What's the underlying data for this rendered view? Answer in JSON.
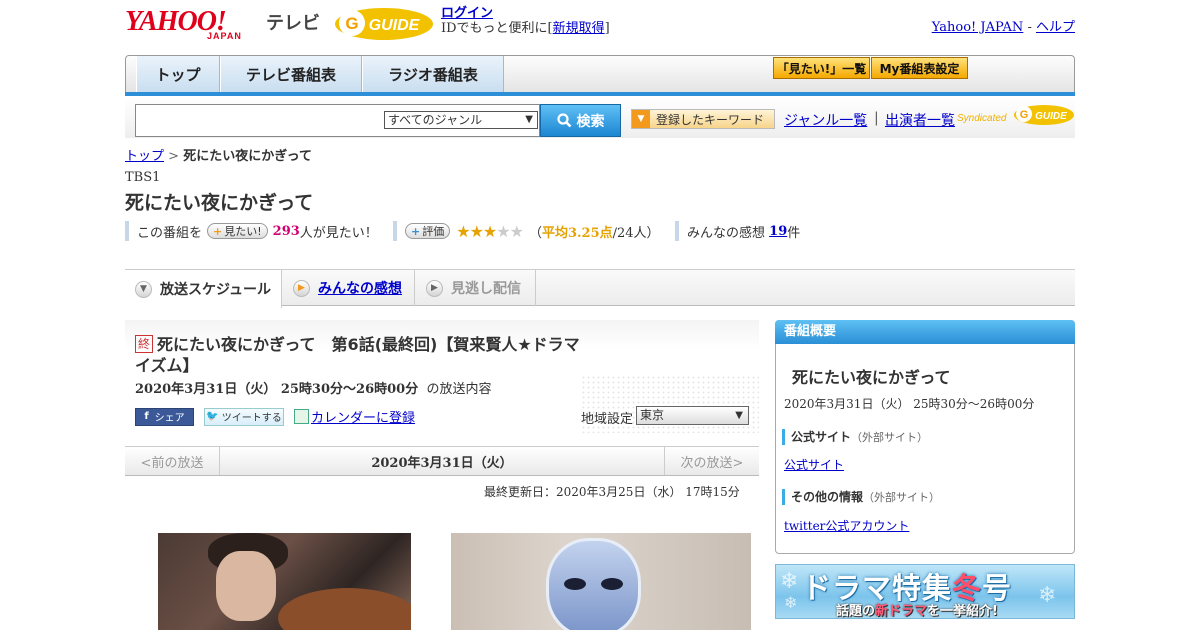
{
  "header": {
    "yahoo_logo_text": "YAHOO!",
    "yahoo_logo_sub": "JAPAN",
    "service_name": "テレビ",
    "gguide_logo_text": "G GUIDE",
    "login": "ログイン",
    "login_prompt": "IDでもっと便利に[",
    "signup": "新規取得",
    "login_prompt_end": "]",
    "yahoo_japan_link": "Yahoo! JAPAN",
    "help_sep": " - ",
    "help_link": "ヘルプ"
  },
  "nav": {
    "tabs": [
      {
        "label": "トップ"
      },
      {
        "label": "テレビ番組表"
      },
      {
        "label": "ラジオ番組表"
      }
    ],
    "mitai_list": "「見たい!」一覧",
    "my_table": "My番組表設定"
  },
  "search": {
    "genre_selected": "すべてのジャンル",
    "button_label": "検索",
    "keyword_button": "登録したキーワード",
    "genre_link": "ジャンル一覧",
    "separator": "|",
    "cast_link": "出演者一覧",
    "syndicated": "Syndicated"
  },
  "breadcrumb": {
    "top": "トップ",
    "sep": " > ",
    "current": "死にたい夜にかぎって"
  },
  "program": {
    "channel": "TBS1",
    "title": "死にたい夜にかぎって",
    "mitai_prefix": "この番組を",
    "mitai_pill": "見たい!",
    "mitai_count": "293",
    "mitai_suffix": "人が見たい！",
    "rate_pill": "評価",
    "rating_average": 3.25,
    "stars_filled": "★★★",
    "stars_empty": "★★",
    "rating_open": "（",
    "rating_avg_text": "平均3.25点",
    "rating_count_text": "/24人）",
    "review_label": "みんなの感想",
    "review_count": "19",
    "review_suffix": "件"
  },
  "tabs": {
    "schedule": "放送スケジュール",
    "reviews": "みんなの感想",
    "catchup": "見逃し配信"
  },
  "episode": {
    "end_badge": "終",
    "title": "死にたい夜にかぎって　第6話(最終回)【賀来賢人★ドラマイズム】",
    "time": "2020年3月31日（火）  25時30分～26時00分",
    "time_suffix": "の放送内容",
    "share_fb": "シェア",
    "share_tw": "ツイートする",
    "calendar": "カレンダーに登録",
    "region_label": "地域設定",
    "region_selected": "東京"
  },
  "date_nav": {
    "prev": "<前の放送",
    "current": "2020年3月31日（火）",
    "next": "次の放送>"
  },
  "updated": "最終更新日：2020年3月25日（水）  17時15分",
  "overview": {
    "header": "番組概要",
    "title": "死にたい夜にかぎって",
    "time": "2020年3月31日（火）  25時30分～26時00分",
    "official_label": "公式サイト",
    "external": "（外部サイト）",
    "official_link": "公式サイト",
    "other_label": "その他の情報",
    "twitter_link": "twitter公式アカウント"
  },
  "banner": {
    "big_a": "ドラマ特集",
    "big_b": "冬",
    "big_c": "号",
    "small_a": "話題の",
    "small_b": "新ドラマ",
    "small_c": "を一挙紹介!"
  },
  "colors": {
    "accent_blue": "#2c8fd8",
    "link": "#0000cc",
    "star": "#e6a200",
    "count_red": "#d0006f"
  }
}
